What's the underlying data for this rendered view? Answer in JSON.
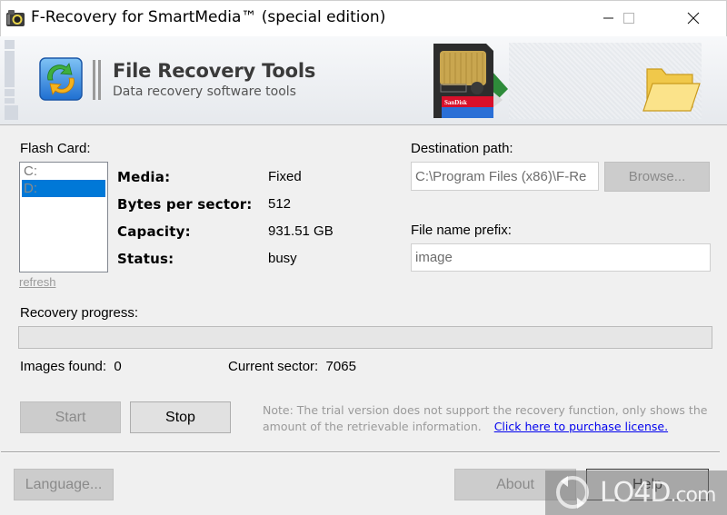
{
  "window": {
    "title": "F-Recovery for SmartMedia™ (special edition)",
    "controls": {
      "minimize": "minimize",
      "maximize": "maximize",
      "close": "close"
    }
  },
  "banner": {
    "brand_title": "File Recovery Tools",
    "brand_subtitle": "Data recovery software tools",
    "card_label": "SanDisk SmartMedia"
  },
  "flash_card": {
    "label": "Flash Card:",
    "drives": [
      {
        "label": "C:",
        "selected": false
      },
      {
        "label": "D:",
        "selected": true
      }
    ],
    "refresh_label": "refresh"
  },
  "info": [
    {
      "label": "Media:",
      "value": "Fixed"
    },
    {
      "label": "Bytes per sector:",
      "value": "512"
    },
    {
      "label": "Capacity:",
      "value": "931.51 GB"
    },
    {
      "label": "Status:",
      "value": "busy"
    }
  ],
  "destination": {
    "label": "Destination path:",
    "value": "C:\\Program Files (x86)\\F-Re",
    "browse_label": "Browse..."
  },
  "prefix": {
    "label": "File name prefix:",
    "value": "image"
  },
  "progress": {
    "label": "Recovery progress:",
    "percent": 0
  },
  "stats": {
    "images_found_label": "Images found:",
    "images_found": "0",
    "current_sector_label": "Current sector:",
    "current_sector": "7065"
  },
  "actions": {
    "start_label": "Start",
    "stop_label": "Stop"
  },
  "note": {
    "text": "Note: The trial version does not support the recovery function, only shows the amount of the retrievable information.",
    "link_label": "Click here to purchase license."
  },
  "footer": {
    "language_label": "Language...",
    "about_label": "About",
    "help_label": "Help"
  },
  "watermark": {
    "text": "LO4D",
    "suffix": ".com"
  },
  "colors": {
    "selection": "#0078d7",
    "link": "#0000ee",
    "disabled_text": "#8a8a8a"
  }
}
